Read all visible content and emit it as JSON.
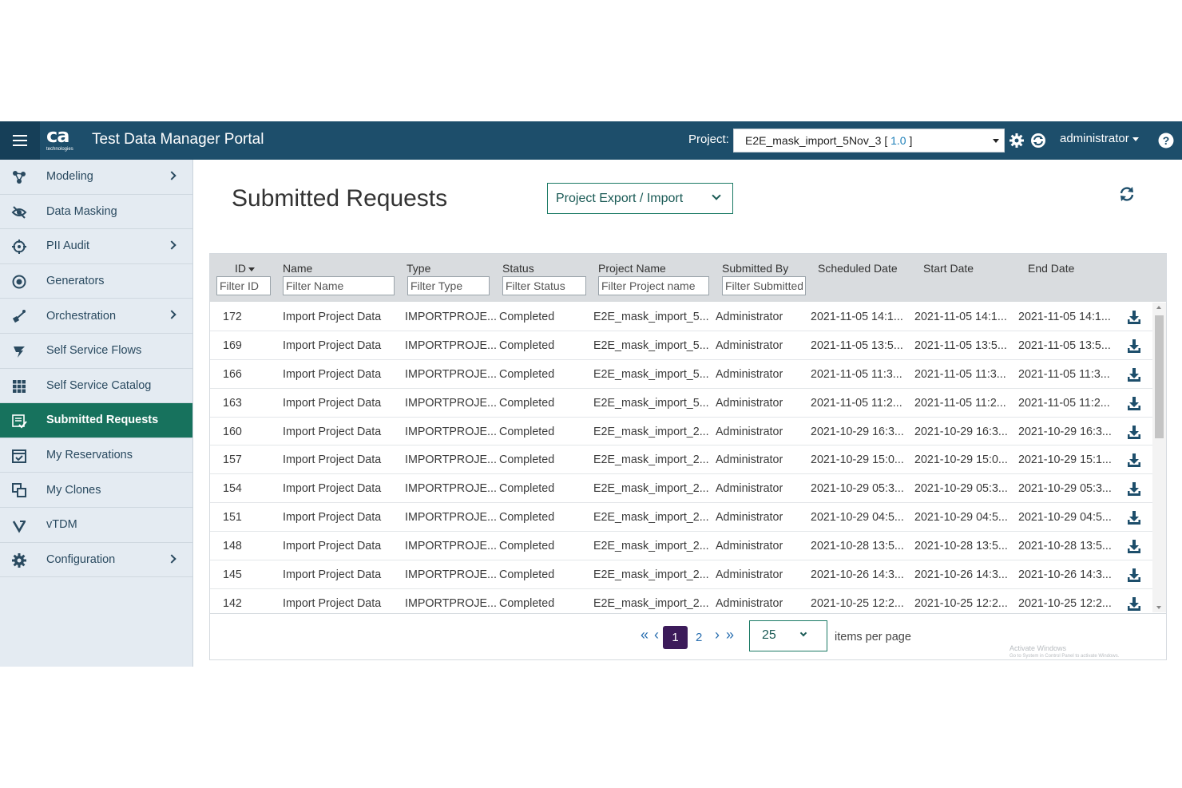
{
  "header": {
    "logo_text": "ca",
    "logo_sub": "technologies",
    "title": "Test Data Manager Portal",
    "project_label": "Project:",
    "project_name": "E2E_mask_import_5Nov_3",
    "project_version": "1.0",
    "user": "administrator"
  },
  "colors": {
    "header_bg": "#1d4e6b",
    "active_nav": "#17725d",
    "accent": "#1a7a64",
    "pager_active": "#3c1b5a"
  },
  "sidebar": {
    "items": [
      {
        "label": "Modeling",
        "icon": "modeling-icon",
        "has_children": true
      },
      {
        "label": "Data Masking",
        "icon": "masking-icon",
        "has_children": false
      },
      {
        "label": "PII Audit",
        "icon": "audit-icon",
        "has_children": true
      },
      {
        "label": "Generators",
        "icon": "generators-icon",
        "has_children": false
      },
      {
        "label": "Orchestration",
        "icon": "orchestration-icon",
        "has_children": true
      },
      {
        "label": "Self Service Flows",
        "icon": "flows-icon",
        "has_children": false
      },
      {
        "label": "Self Service Catalog",
        "icon": "catalog-icon",
        "has_children": false
      },
      {
        "label": "Submitted Requests",
        "icon": "requests-icon",
        "has_children": false,
        "active": true
      },
      {
        "label": "My Reservations",
        "icon": "reservations-icon",
        "has_children": false
      },
      {
        "label": "My Clones",
        "icon": "clones-icon",
        "has_children": false
      },
      {
        "label": "vTDM",
        "icon": "vtdm-icon",
        "has_children": false
      },
      {
        "label": "Configuration",
        "icon": "gear-icon",
        "has_children": true
      }
    ]
  },
  "main": {
    "title": "Submitted Requests",
    "type_filter": "Project Export / Import"
  },
  "table": {
    "columns": [
      {
        "title": "ID",
        "placeholder": "Filter ID"
      },
      {
        "title": "Name",
        "placeholder": "Filter Name"
      },
      {
        "title": "Type",
        "placeholder": "Filter Type"
      },
      {
        "title": "Status",
        "placeholder": "Filter Status"
      },
      {
        "title": "Project Name",
        "placeholder": "Filter Project name"
      },
      {
        "title": "Submitted By",
        "placeholder": "Filter Submitted By"
      },
      {
        "title": "Scheduled Date",
        "placeholder": ""
      },
      {
        "title": "Start Date",
        "placeholder": ""
      },
      {
        "title": "End Date",
        "placeholder": ""
      }
    ],
    "rows": [
      [
        "172",
        "Import Project Data",
        "IMPORTPROJE...",
        "Completed",
        "E2E_mask_import_5...",
        "Administrator",
        "2021-11-05 14:1...",
        "2021-11-05 14:1...",
        "2021-11-05 14:1..."
      ],
      [
        "169",
        "Import Project Data",
        "IMPORTPROJE...",
        "Completed",
        "E2E_mask_import_5...",
        "Administrator",
        "2021-11-05 13:5...",
        "2021-11-05 13:5...",
        "2021-11-05 13:5..."
      ],
      [
        "166",
        "Import Project Data",
        "IMPORTPROJE...",
        "Completed",
        "E2E_mask_import_5...",
        "Administrator",
        "2021-11-05 11:3...",
        "2021-11-05 11:3...",
        "2021-11-05 11:3..."
      ],
      [
        "163",
        "Import Project Data",
        "IMPORTPROJE...",
        "Completed",
        "E2E_mask_import_5...",
        "Administrator",
        "2021-11-05 11:2...",
        "2021-11-05 11:2...",
        "2021-11-05 11:2..."
      ],
      [
        "160",
        "Import Project Data",
        "IMPORTPROJE...",
        "Completed",
        "E2E_mask_import_2...",
        "Administrator",
        "2021-10-29 16:3...",
        "2021-10-29 16:3...",
        "2021-10-29 16:3..."
      ],
      [
        "157",
        "Import Project Data",
        "IMPORTPROJE...",
        "Completed",
        "E2E_mask_import_2...",
        "Administrator",
        "2021-10-29 15:0...",
        "2021-10-29 15:0...",
        "2021-10-29 15:1..."
      ],
      [
        "154",
        "Import Project Data",
        "IMPORTPROJE...",
        "Completed",
        "E2E_mask_import_2...",
        "Administrator",
        "2021-10-29 05:3...",
        "2021-10-29 05:3...",
        "2021-10-29 05:3..."
      ],
      [
        "151",
        "Import Project Data",
        "IMPORTPROJE...",
        "Completed",
        "E2E_mask_import_2...",
        "Administrator",
        "2021-10-29 04:5...",
        "2021-10-29 04:5...",
        "2021-10-29 04:5..."
      ],
      [
        "148",
        "Import Project Data",
        "IMPORTPROJE...",
        "Completed",
        "E2E_mask_import_2...",
        "Administrator",
        "2021-10-28 13:5...",
        "2021-10-28 13:5...",
        "2021-10-28 13:5..."
      ],
      [
        "145",
        "Import Project Data",
        "IMPORTPROJE...",
        "Completed",
        "E2E_mask_import_2...",
        "Administrator",
        "2021-10-26 14:3...",
        "2021-10-26 14:3...",
        "2021-10-26 14:3..."
      ],
      [
        "142",
        "Import Project Data",
        "IMPORTPROJE...",
        "Completed",
        "E2E_mask_import_2...",
        "Administrator",
        "2021-10-25 12:2...",
        "2021-10-25 12:2...",
        "2021-10-25 12:2..."
      ]
    ]
  },
  "pagination": {
    "first": "«",
    "prev": "‹",
    "current": "1",
    "next_page": "2",
    "next": "›",
    "last": "»",
    "per_page": "25",
    "per_page_label": "items per page"
  },
  "watermark": {
    "title": "Activate Windows",
    "subtitle": "Go to System in Control Panel to activate Windows."
  }
}
